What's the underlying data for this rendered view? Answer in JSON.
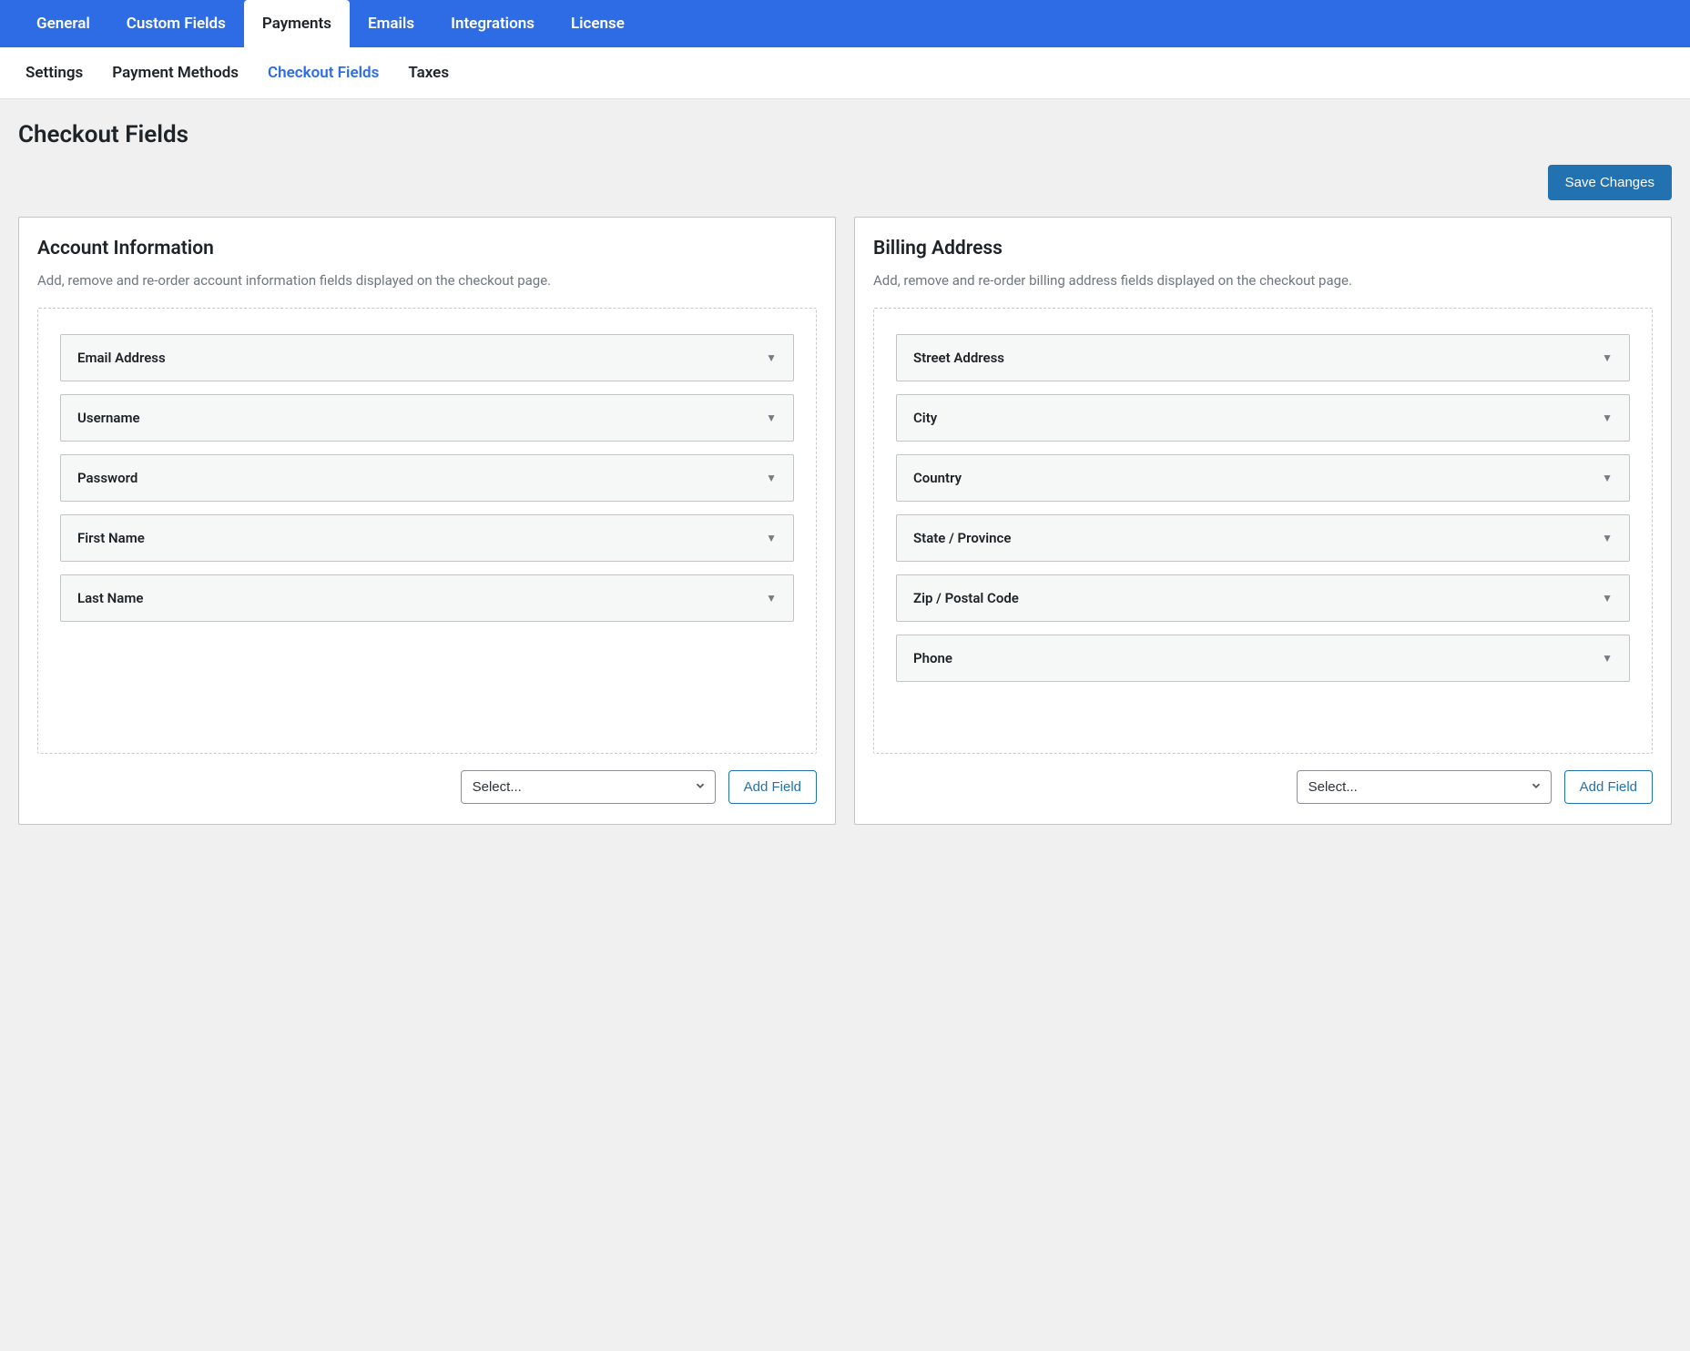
{
  "primaryNav": {
    "tabs": [
      {
        "label": "General"
      },
      {
        "label": "Custom Fields"
      },
      {
        "label": "Payments",
        "active": true
      },
      {
        "label": "Emails"
      },
      {
        "label": "Integrations"
      },
      {
        "label": "License"
      }
    ]
  },
  "subNav": {
    "tabs": [
      {
        "label": "Settings"
      },
      {
        "label": "Payment Methods"
      },
      {
        "label": "Checkout Fields",
        "active": true
      },
      {
        "label": "Taxes"
      }
    ]
  },
  "pageTitle": "Checkout Fields",
  "saveButton": "Save Changes",
  "panels": {
    "account": {
      "title": "Account Information",
      "desc": "Add, remove and re-order account information fields displayed on the checkout page.",
      "fields": [
        {
          "label": "Email Address"
        },
        {
          "label": "Username"
        },
        {
          "label": "Password"
        },
        {
          "label": "First Name"
        },
        {
          "label": "Last Name"
        }
      ],
      "selectPlaceholder": "Select...",
      "addButton": "Add Field"
    },
    "billing": {
      "title": "Billing Address",
      "desc": "Add, remove and re-order billing address fields displayed on the checkout page.",
      "fields": [
        {
          "label": "Street Address"
        },
        {
          "label": "City"
        },
        {
          "label": "Country"
        },
        {
          "label": "State / Province"
        },
        {
          "label": "Zip / Postal Code"
        },
        {
          "label": "Phone"
        }
      ],
      "selectPlaceholder": "Select...",
      "addButton": "Add Field"
    }
  }
}
